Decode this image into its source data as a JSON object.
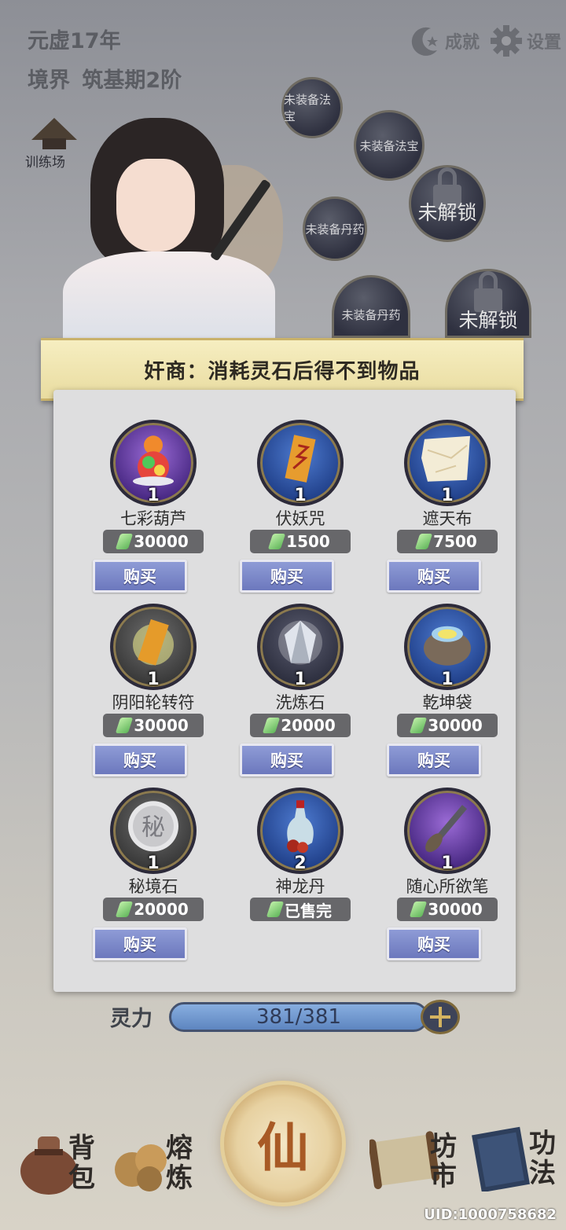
{
  "header": {
    "year": "元虚17年",
    "realm_label": "境界",
    "realm_value": "筑基期2阶",
    "achievement_label": "成就",
    "settings_label": "设置"
  },
  "slots": {
    "treasure_1": "未装备法宝",
    "treasure_2": "未装备法宝",
    "pill_1": "未装备丹药",
    "pill_2": "未装备丹药",
    "locked_1": "未解锁",
    "locked_2": "未解锁",
    "training": "训练场"
  },
  "banner": {
    "text": "奸商：消耗灵石后得不到物品"
  },
  "shop": {
    "buy_label": "购买",
    "items": [
      {
        "name": "七彩葫芦",
        "qty": "1",
        "price": "30000",
        "icon": "gourd-icon"
      },
      {
        "name": "伏妖咒",
        "qty": "1",
        "price": "1500",
        "icon": "talisman-icon"
      },
      {
        "name": "遮天布",
        "qty": "1",
        "price": "7500",
        "icon": "cloth-icon"
      },
      {
        "name": "阴阳轮转符",
        "qty": "1",
        "price": "30000",
        "icon": "charm-icon"
      },
      {
        "name": "洗炼石",
        "qty": "1",
        "price": "20000",
        "icon": "crystal-icon"
      },
      {
        "name": "乾坤袋",
        "qty": "1",
        "price": "30000",
        "icon": "pouch-icon"
      },
      {
        "name": "秘境石",
        "qty": "1",
        "price": "20000",
        "icon": "secret-stone-icon"
      },
      {
        "name": "神龙丹",
        "qty": "2",
        "price": "已售完",
        "icon": "vase-icon"
      },
      {
        "name": "随心所欲笔",
        "qty": "1",
        "price": "30000",
        "icon": "brush-icon"
      }
    ]
  },
  "spirit": {
    "label": "灵力",
    "value": "381/381",
    "fill": 1.0
  },
  "nav": {
    "bag": "背包",
    "smelt": "熔炼",
    "center": "仙",
    "market": "坊市",
    "skills": "功法"
  },
  "uid": "UID:1000758682",
  "colors": {
    "buy_button": "#7a86c8",
    "banner": "#efe4b0",
    "panel": "#dededf"
  }
}
